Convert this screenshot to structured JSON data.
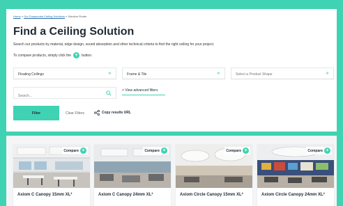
{
  "breadcrumb": {
    "home": "Home",
    "sep1": " » ",
    "parent": "Our Suspended Ceiling Solutions",
    "sep2": " » ",
    "current": "Solution Finder"
  },
  "page_title": "Find a Ceiling Solution",
  "intro_text": "Search our products by material, edge design, sound absorption and other technical criteria to find the right ceiling for your project.",
  "compare_hint": {
    "before": "To compare products, simply click the",
    "after": "button."
  },
  "filters": {
    "category": "Floating Ceilings",
    "edge": "Frame & Tile",
    "shape_placeholder": "Select a Product Shape",
    "search_placeholder": "Search...",
    "advanced_link": "> View advanced filters",
    "filter_button": "Filter",
    "clear_button": "Clear Filters",
    "copy_url": "Copy results URL"
  },
  "compare_label": "Compare",
  "products": [
    {
      "name": "Axiom C Canopy 15mm XL²"
    },
    {
      "name": "Axiom C Canopy 24mm XL²"
    },
    {
      "name": "Axiom Circle Canopy 15mm XL²"
    },
    {
      "name": "Axiom Circle Canopy 24mm XL²"
    }
  ],
  "colors": {
    "accent": "#3fd3b3",
    "title": "#1f2a36",
    "link": "#2a6fb0"
  },
  "icons": [
    "plus-icon",
    "chevron-icon",
    "search-icon",
    "share-icon"
  ]
}
